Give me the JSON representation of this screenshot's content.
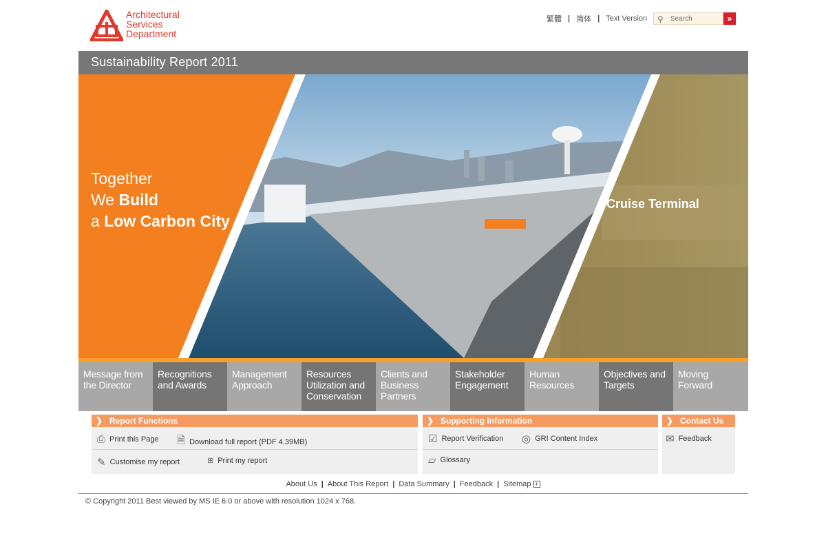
{
  "header": {
    "logo_lines": [
      "Architectural",
      "Services",
      "Department"
    ],
    "brand_color": "#e03a2f",
    "lang_links": [
      "繁體",
      "简体",
      "Text Version"
    ],
    "search": {
      "placeholder": "Search",
      "icon": "magnifier-icon",
      "go_icon": "double-chevron-right-icon"
    }
  },
  "report_bar": {
    "title": "Sustainability Report 2011"
  },
  "hero": {
    "line1": "Together",
    "line2_pre": "We ",
    "line2_bold": "Build",
    "line3_pre": "a ",
    "line3_bold": "Low Carbon City",
    "side_label": "Cruise Terminal",
    "colors": {
      "orange": "#f47f1e",
      "olive": "#a3905a"
    }
  },
  "nav": [
    {
      "label": "Message from the Director"
    },
    {
      "label": "Recognitions and Awards"
    },
    {
      "label": "Management Approach"
    },
    {
      "label": "Resources Utilization and Conservation"
    },
    {
      "label": "Clients and Business Partners"
    },
    {
      "label": "Stakeholder Engagement"
    },
    {
      "label": "Human Resources"
    },
    {
      "label": "Objectives and Targets"
    },
    {
      "label": "Moving Forward"
    }
  ],
  "report_functions": {
    "title": "Report Functions",
    "print_page": "Print this Page",
    "download": "Download full report (PDF 4.39MB)",
    "customise": "Customise my report",
    "print_report": "Print my report"
  },
  "supporting": {
    "title": "Supporting Information",
    "verification": "Report Verification",
    "gri": "GRI Content Index",
    "glossary": "Glossary"
  },
  "contact": {
    "title": "Contact Us",
    "feedback": "Feedback"
  },
  "footer": {
    "links": [
      "About Us",
      "About This Report",
      "Data Summary",
      "Feedback",
      "Sitemap"
    ],
    "copyright": "© Copyright 2011 Best viewed by MS IE 6.0 or above with resolution 1024 x 768."
  }
}
